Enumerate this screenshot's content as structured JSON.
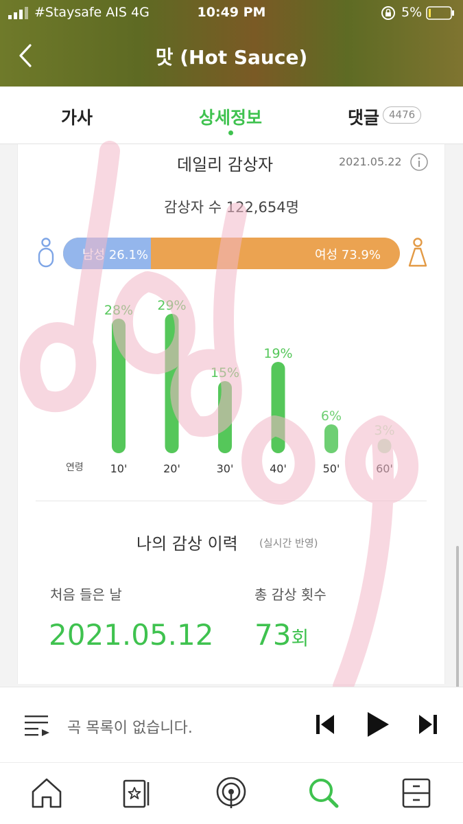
{
  "status_bar": {
    "carrier": "#Staysafe AIS  4G",
    "time": "10:49 PM",
    "battery": "5%"
  },
  "header": {
    "title": "맛 (Hot Sauce)"
  },
  "tabs": [
    {
      "label": "가사"
    },
    {
      "label": "상세정보",
      "active": true
    },
    {
      "label": "댓글",
      "badge": "4476"
    }
  ],
  "daily": {
    "title": "데일리 감상자",
    "date": "2021.05.22",
    "listener_count": "감상자 수 122,654명",
    "male_label": "남성 26.1%",
    "female_label": "여성 73.9%",
    "male_share": 26.1,
    "female_share": 73.9,
    "age_axis_label": "연령"
  },
  "chart_data": {
    "type": "bar",
    "categories": [
      "10'",
      "20'",
      "30'",
      "40'",
      "50'",
      "60'"
    ],
    "values": [
      28,
      29,
      15,
      19,
      6,
      3
    ],
    "value_labels": [
      "28%",
      "29%",
      "15%",
      "19%",
      "6%",
      "3%"
    ],
    "xlabel": "연령",
    "ylabel": "",
    "title": "",
    "grid": false,
    "bar_color": "#55c75a"
  },
  "history": {
    "title": "나의 감상 이력",
    "note": "(실시간 반영)",
    "first_listen_label": "처음 들은 날",
    "first_listen_value": "2021.05.12",
    "total_label": "총 감상 횟수",
    "total_value": "73",
    "total_unit": "회"
  },
  "player": {
    "empty_text": "곡 목록이 없습니다."
  },
  "nav": {
    "items": [
      "home-icon",
      "my-music-icon",
      "station-icon",
      "search-icon",
      "more-icon"
    ],
    "active": "search-icon"
  },
  "colors": {
    "accent": "#3fc24f",
    "male": "#94b6ec",
    "female": "#eba351"
  }
}
